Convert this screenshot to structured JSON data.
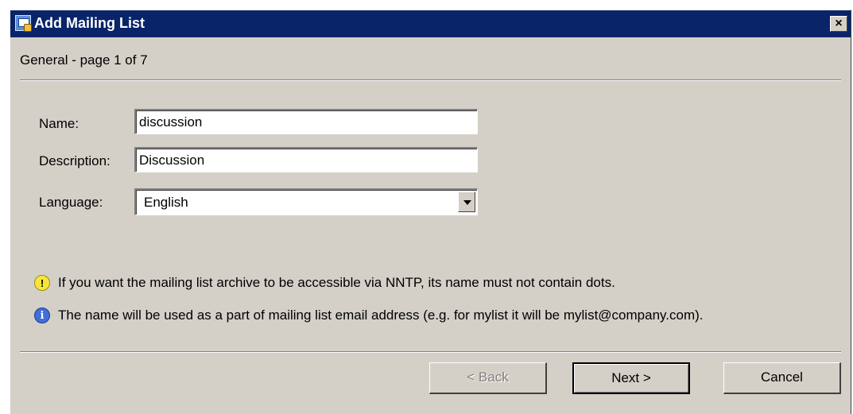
{
  "window": {
    "title": "Add Mailing List",
    "close_glyph": "×"
  },
  "page_indicator": "General - page 1 of 7",
  "form": {
    "name_label": "Name:",
    "name_value": "discussion",
    "description_label": "Description:",
    "description_value": "Discussion",
    "language_label": "Language:",
    "language_value": "English"
  },
  "notes": {
    "warning_glyph": "!",
    "warning_text": "If you want the mailing list archive to be accessible via NNTP, its name must not contain dots.",
    "info_glyph": "i",
    "info_text": "The name will be used as a part of mailing list email address (e.g. for mylist it will be mylist@company.com)."
  },
  "buttons": {
    "back_label": "< Back",
    "next_label": "Next >",
    "cancel_label": "Cancel"
  },
  "colors": {
    "titlebar": "#0a246a",
    "dialog_bg": "#d4d0c8",
    "warning_icon": "#f7e63a",
    "info_icon": "#3f6fd8"
  },
  "icons": {
    "app": "mailing-list-app-icon",
    "close": "close-icon",
    "dropdown": "chevron-down-icon",
    "warning": "warning-icon",
    "info": "info-icon"
  }
}
